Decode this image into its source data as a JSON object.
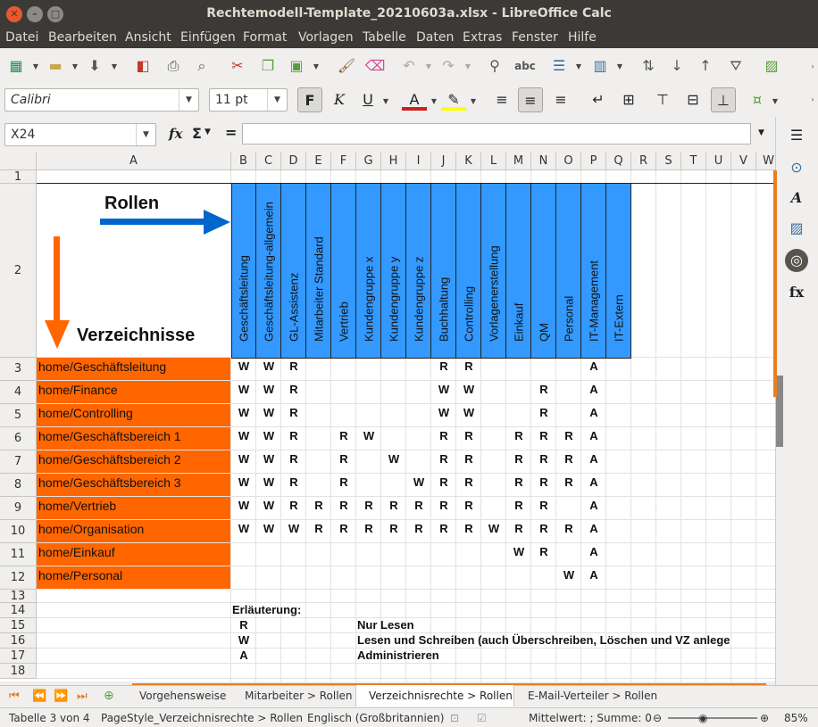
{
  "window": {
    "title": "Rechtemodell-Template_20210603a.xlsx - LibreOffice Calc"
  },
  "menu": [
    "Datei",
    "Bearbeiten",
    "Ansicht",
    "Einfügen",
    "Format",
    "Vorlagen",
    "Tabelle",
    "Daten",
    "Extras",
    "Fenster",
    "Hilfe"
  ],
  "format": {
    "font_name": "Calibri",
    "font_size": "11 pt"
  },
  "formula": {
    "cell_ref": "X24",
    "fx": "fx",
    "sum": "Σ",
    "eq": "=",
    "content": ""
  },
  "columns": [
    "A",
    "B",
    "C",
    "D",
    "E",
    "F",
    "G",
    "H",
    "I",
    "J",
    "K",
    "L",
    "M",
    "N",
    "O",
    "P",
    "Q",
    "R",
    "S",
    "T",
    "U",
    "V",
    "W"
  ],
  "rows": [
    "1",
    "2",
    "3",
    "4",
    "5",
    "6",
    "7",
    "8",
    "9",
    "10",
    "11",
    "12",
    "13",
    "14",
    "15",
    "16",
    "17",
    "18"
  ],
  "sheet": {
    "rollen_label": "Rollen",
    "verzeichnisse_label": "Verzeichnisse",
    "roles": [
      "Geschäftsleitung",
      "Geschäftsleitung-allgemein",
      "GL-Assistenz",
      "Mitarbeiter Standard",
      "Vertrieb",
      "Kundengruppe x",
      "Kundengruppe y",
      "Kundengruppe z",
      "Buchhaltung",
      "Controlling",
      "Vorlagenerstellung",
      "Einkauf",
      "QM",
      "Personal",
      "IT-Management",
      "IT-Extern"
    ],
    "directories": [
      {
        "name": "home/Geschäftsleitung",
        "rights": [
          "W",
          "W",
          "R",
          "",
          "",
          "",
          "",
          "",
          "R",
          "R",
          "",
          "",
          "",
          "",
          "A",
          ""
        ]
      },
      {
        "name": "home/Finance",
        "rights": [
          "W",
          "W",
          "R",
          "",
          "",
          "",
          "",
          "",
          "W",
          "W",
          "",
          "",
          "R",
          "",
          "A",
          ""
        ]
      },
      {
        "name": "home/Controlling",
        "rights": [
          "W",
          "W",
          "R",
          "",
          "",
          "",
          "",
          "",
          "W",
          "W",
          "",
          "",
          "R",
          "",
          "A",
          ""
        ]
      },
      {
        "name": "home/Geschäftsbereich 1",
        "rights": [
          "W",
          "W",
          "R",
          "",
          "R",
          "W",
          "",
          "",
          "R",
          "R",
          "",
          "R",
          "R",
          "R",
          "A",
          ""
        ]
      },
      {
        "name": "home/Geschäftsbereich 2",
        "rights": [
          "W",
          "W",
          "R",
          "",
          "R",
          "",
          "W",
          "",
          "R",
          "R",
          "",
          "R",
          "R",
          "R",
          "A",
          ""
        ]
      },
      {
        "name": "home/Geschäftsbereich 3",
        "rights": [
          "W",
          "W",
          "R",
          "",
          "R",
          "",
          "",
          "W",
          "R",
          "R",
          "",
          "R",
          "R",
          "R",
          "A",
          ""
        ]
      },
      {
        "name": "home/Vertrieb",
        "rights": [
          "W",
          "W",
          "R",
          "R",
          "R",
          "R",
          "R",
          "R",
          "R",
          "R",
          "",
          "R",
          "R",
          "",
          "A",
          ""
        ]
      },
      {
        "name": "home/Organisation",
        "rights": [
          "W",
          "W",
          "W",
          "R",
          "R",
          "R",
          "R",
          "R",
          "R",
          "R",
          "W",
          "R",
          "R",
          "R",
          "A",
          ""
        ]
      },
      {
        "name": "home/Einkauf",
        "rights": [
          "",
          "",
          "",
          "",
          "",
          "",
          "",
          "",
          "",
          "",
          "",
          "W",
          "R",
          "",
          "A",
          ""
        ]
      },
      {
        "name": "home/Personal",
        "rights": [
          "",
          "",
          "",
          "",
          "",
          "",
          "",
          "",
          "",
          "",
          "",
          "",
          "",
          "W",
          "A",
          ""
        ]
      }
    ],
    "legend_title": "Erläuterung:",
    "legend": [
      {
        "key": "R",
        "text": "Nur Lesen"
      },
      {
        "key": "W",
        "text": "Lesen und Schreiben (auch Überschreiben, Löschen und VZ anlege"
      },
      {
        "key": "A",
        "text": "Administrieren"
      }
    ],
    "colors": {
      "roles_header": "#3399ff",
      "directories": "#ff6600",
      "rollen_arrow": "#0066cc",
      "verz_arrow": "#ff6600"
    }
  },
  "tabs": [
    "Vorgehensweise",
    "Mitarbeiter > Rollen",
    "Verzeichnisrechte > Rollen",
    "E-Mail-Verteiler > Rollen"
  ],
  "active_tab": "Verzeichnisrechte > Rollen",
  "status": {
    "sheet": "Tabelle 3 von 4",
    "page_style": "PageStyle_Verzeichnisrechte > Rollen",
    "language": "Englisch (Großbritannien)",
    "summary": "Mittelwert: ; Summe: 0",
    "zoom": "85%"
  }
}
